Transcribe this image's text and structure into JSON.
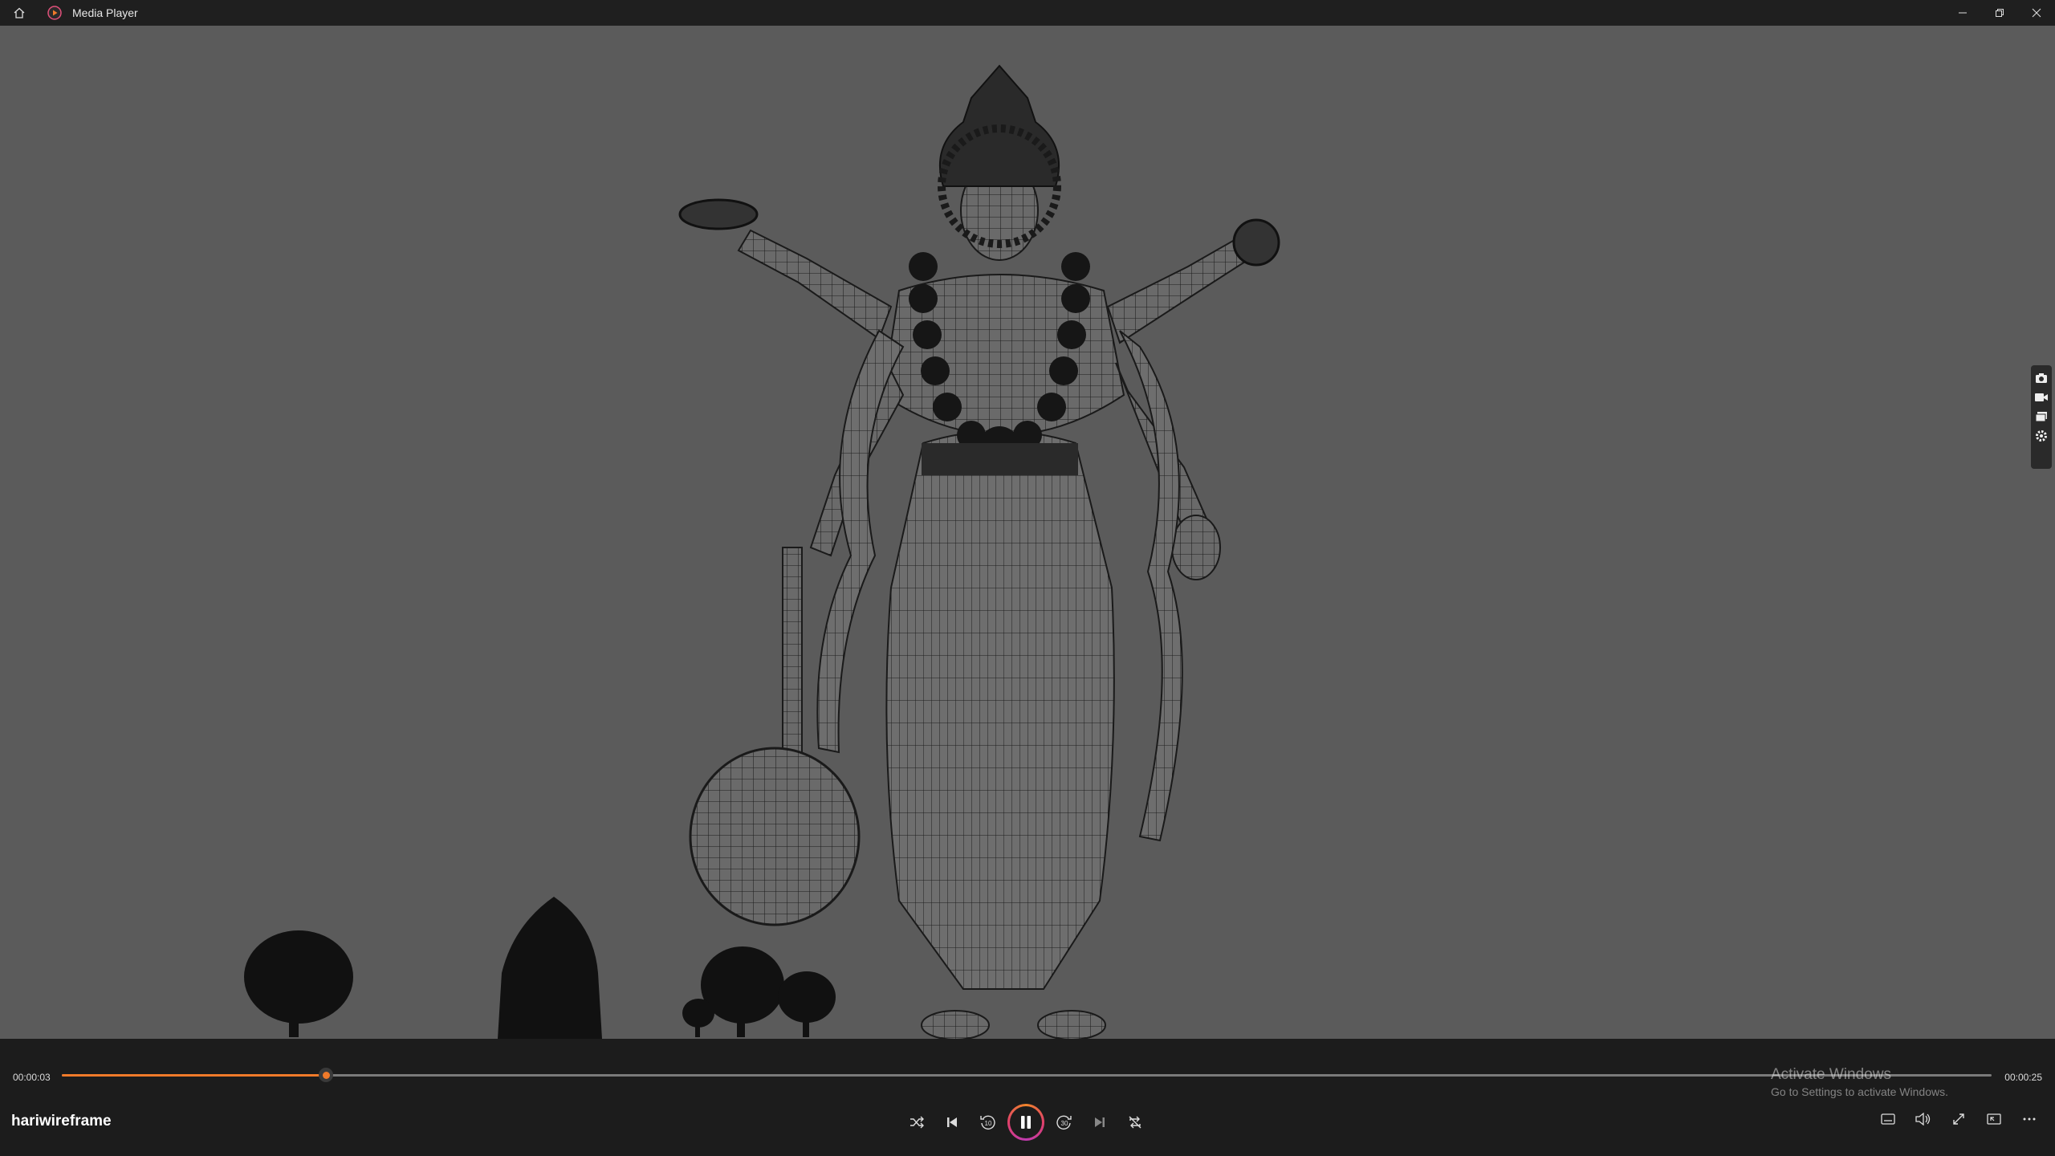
{
  "window": {
    "title": "Media Player"
  },
  "playback": {
    "current_time": "00:00:03",
    "total_time": "00:00:25",
    "progress": 0.137,
    "title": "hariwireframe",
    "state": "playing"
  },
  "watermark": {
    "line1": "Activate Windows",
    "line2": "Go to Settings to activate Windows."
  },
  "colors": {
    "accent": "#f07a2a",
    "titlebar": "#1f1f1f",
    "controlbar": "#1c1c1c",
    "video_bg": "#5b5b5b"
  },
  "icons": {
    "titlebar": [
      "home-icon",
      "media-player-icon",
      "minimize-icon",
      "restore-icon",
      "close-icon"
    ],
    "side_tools": [
      "camera-icon",
      "video-camera-icon",
      "gallery-icon",
      "settings-icon"
    ],
    "center": [
      "shuffle-icon",
      "previous-icon",
      "rewind-10-icon",
      "pause-icon",
      "forward-30-icon",
      "next-icon",
      "repeat-off-icon"
    ],
    "right": [
      "captions-icon",
      "volume-icon",
      "fullscreen-icon",
      "mini-player-icon",
      "more-icon"
    ]
  }
}
